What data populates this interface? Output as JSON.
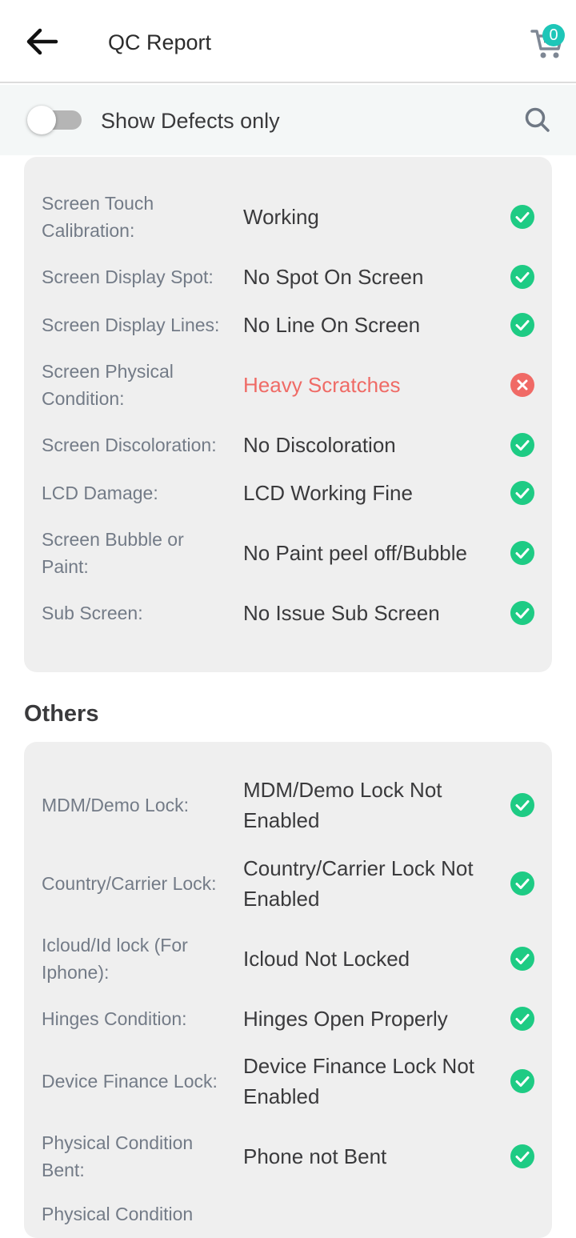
{
  "header": {
    "title": "QC Report",
    "cart_count": "0"
  },
  "filter": {
    "toggle_label": "Show Defects only"
  },
  "colors": {
    "pass": "#1ecb84",
    "fail": "#f06a66",
    "badge": "#1ec6b8"
  },
  "screen_items": [
    {
      "label": "Screen Touch Calibration:",
      "value": "Working",
      "status": "pass"
    },
    {
      "label": "Screen Display Spot:",
      "value": "No Spot On Screen",
      "status": "pass"
    },
    {
      "label": "Screen Display Lines:",
      "value": "No Line On Screen",
      "status": "pass"
    },
    {
      "label": "Screen Physical Condition:",
      "value": "Heavy Scratches",
      "status": "fail"
    },
    {
      "label": "Screen Discoloration:",
      "value": "No Discoloration",
      "status": "pass"
    },
    {
      "label": "LCD Damage:",
      "value": "LCD Working Fine",
      "status": "pass"
    },
    {
      "label": "Screen Bubble or Paint:",
      "value": "No Paint peel off/Bubble",
      "status": "pass"
    },
    {
      "label": "Sub Screen:",
      "value": "No Issue Sub Screen",
      "status": "pass"
    }
  ],
  "others": {
    "title": "Others",
    "items": [
      {
        "label": "MDM/Demo Lock:",
        "value": "MDM/Demo Lock Not Enabled",
        "status": "pass"
      },
      {
        "label": "Country/Carrier Lock:",
        "value": "Country/Carrier Lock Not Enabled",
        "status": "pass"
      },
      {
        "label": "Icloud/Id lock (For Iphone):",
        "value": "Icloud Not Locked",
        "status": "pass"
      },
      {
        "label": "Hinges Condition:",
        "value": "Hinges Open Properly",
        "status": "pass"
      },
      {
        "label": "Device Finance Lock:",
        "value": "Device Finance Lock Not Enabled",
        "status": "pass"
      },
      {
        "label": "Physical Condition Bent:",
        "value": "Phone not Bent",
        "status": "pass"
      },
      {
        "label": "Physical Condition",
        "value": "",
        "status": "none"
      }
    ]
  }
}
